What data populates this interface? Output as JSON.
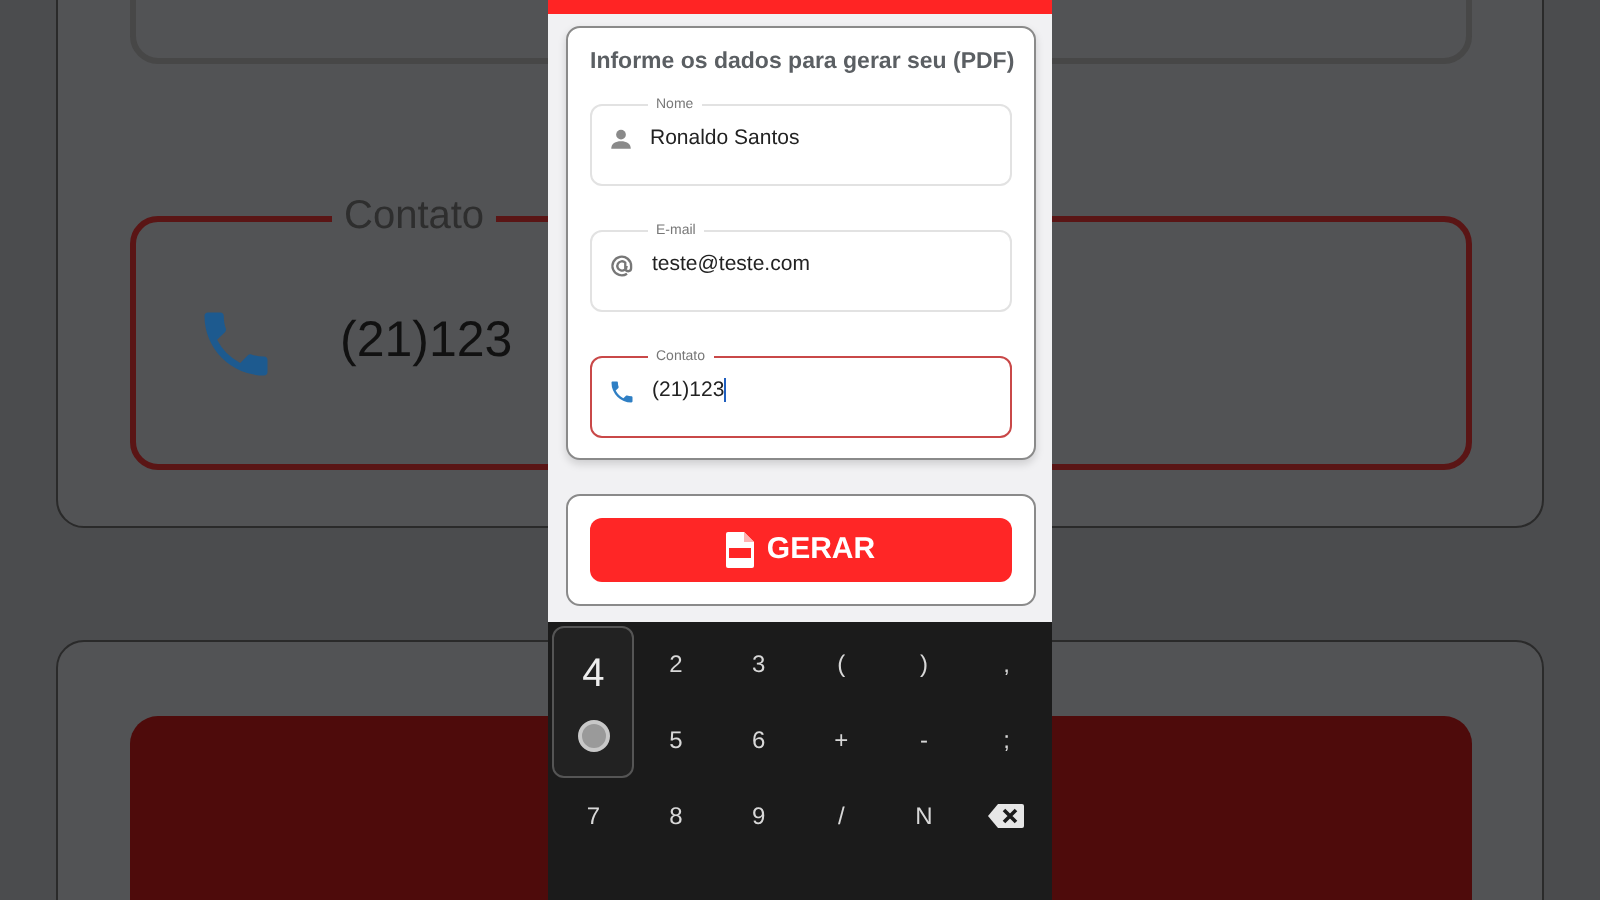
{
  "backdrop": {
    "field_label": "Contato",
    "field_value": "(21)123",
    "field_focused": true
  },
  "form": {
    "title": "Informe os dados para gerar seu (PDF)",
    "fields": [
      {
        "label": "Nome",
        "value": "Ronaldo Santos",
        "kind": "person",
        "focused": false
      },
      {
        "label": "E-mail",
        "value": "teste@teste.com",
        "kind": "email",
        "focused": false
      },
      {
        "label": "Contato",
        "value": "(21)123",
        "kind": "phone",
        "focused": true
      }
    ]
  },
  "button": {
    "label": "GERAR"
  },
  "keyboard": {
    "keys": [
      {
        "label": "4",
        "kind": "char",
        "pressed": true
      },
      {
        "label": "2",
        "kind": "char",
        "pressed": false
      },
      {
        "label": "3",
        "kind": "char",
        "pressed": false
      },
      {
        "label": "(",
        "kind": "char",
        "pressed": false
      },
      {
        "label": ")",
        "kind": "char",
        "pressed": false
      },
      {
        "label": ",",
        "kind": "char",
        "pressed": false
      },
      {
        "label": "5",
        "kind": "char",
        "pressed": false
      },
      {
        "label": "6",
        "kind": "char",
        "pressed": false
      },
      {
        "label": "+",
        "kind": "char",
        "pressed": false
      },
      {
        "label": "-",
        "kind": "char",
        "pressed": false
      },
      {
        "label": ";",
        "kind": "char",
        "pressed": false
      },
      {
        "label": "7",
        "kind": "char",
        "pressed": false
      },
      {
        "label": "8",
        "kind": "char",
        "pressed": false
      },
      {
        "label": "9",
        "kind": "char",
        "pressed": false
      },
      {
        "label": "/",
        "kind": "char",
        "pressed": false
      },
      {
        "label": "N",
        "kind": "char",
        "pressed": false
      },
      {
        "kind": "backspace",
        "pressed": false
      }
    ]
  }
}
